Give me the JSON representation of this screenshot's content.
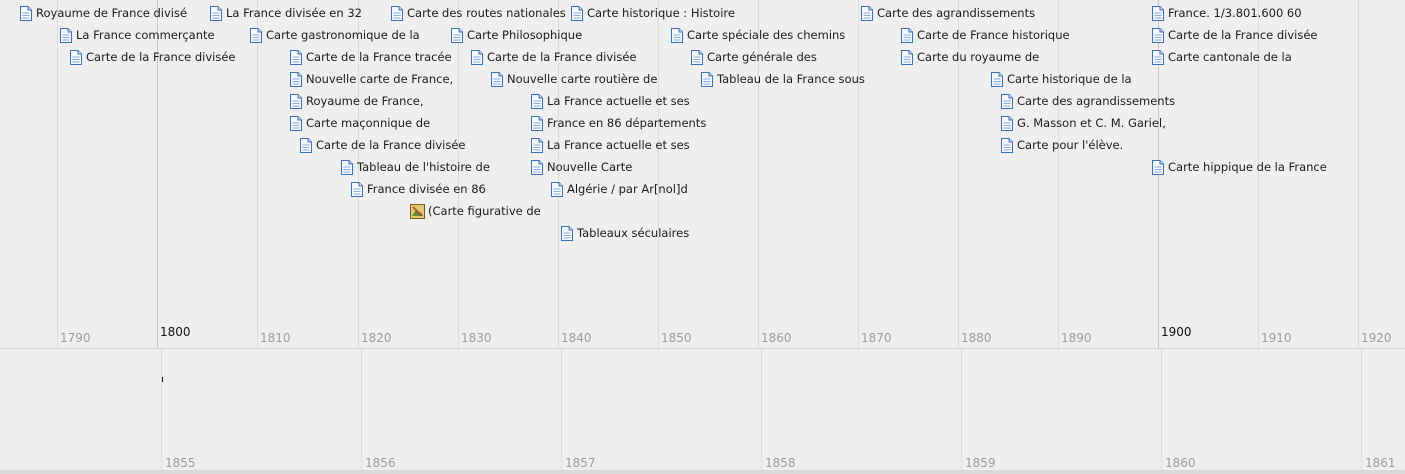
{
  "timeline": {
    "decade_labels": [
      "1790",
      "1800",
      "1810",
      "1820",
      "1830",
      "1840",
      "1850",
      "1860",
      "1870",
      "1880",
      "1890",
      "1900",
      "1910",
      "1920"
    ],
    "events": [
      {
        "label": "Royaume de France divisé",
        "icon": "document-icon"
      },
      {
        "label": "La France commerçante",
        "icon": "document-icon"
      },
      {
        "label": "Carte de la France divisée",
        "icon": "document-icon"
      },
      {
        "label": "La France divisée en 32",
        "icon": "document-icon"
      },
      {
        "label": "Carte gastronomique de la",
        "icon": "document-icon"
      },
      {
        "label": "Carte de la France tracée",
        "icon": "document-icon"
      },
      {
        "label": "Nouvelle carte de France,",
        "icon": "document-icon"
      },
      {
        "label": "Royaume de France,",
        "icon": "document-icon"
      },
      {
        "label": "Carte maçonnique de",
        "icon": "document-icon"
      },
      {
        "label": "Carte de la France divisée",
        "icon": "document-icon"
      },
      {
        "label": "Tableau de l'histoire de",
        "icon": "document-icon"
      },
      {
        "label": "France divisée en 86",
        "icon": "document-icon"
      },
      {
        "label": "(Carte figurative de",
        "icon": "image-icon"
      },
      {
        "label": "Carte des routes nationales",
        "icon": "document-icon"
      },
      {
        "label": "Carte Philosophique",
        "icon": "document-icon"
      },
      {
        "label": "Carte de la France divisée",
        "icon": "document-icon"
      },
      {
        "label": "Nouvelle carte routière de",
        "icon": "document-icon"
      },
      {
        "label": "Carte historique : Histoire",
        "icon": "document-icon"
      },
      {
        "label": "La France actuelle et ses",
        "icon": "document-icon"
      },
      {
        "label": "France en 86 départements",
        "icon": "document-icon"
      },
      {
        "label": "La France actuelle et ses",
        "icon": "document-icon"
      },
      {
        "label": "Nouvelle Carte",
        "icon": "document-icon"
      },
      {
        "label": "Algérie / par Ar[nol]d",
        "icon": "document-icon"
      },
      {
        "label": "Tableaux séculaires",
        "icon": "document-icon"
      },
      {
        "label": "Carte spéciale des chemins",
        "icon": "document-icon"
      },
      {
        "label": "Carte générale des",
        "icon": "document-icon"
      },
      {
        "label": "Tableau de la France sous",
        "icon": "document-icon"
      },
      {
        "label": "Carte des agrandissements",
        "icon": "document-icon"
      },
      {
        "label": "Carte de France historique",
        "icon": "document-icon"
      },
      {
        "label": "Carte du royaume de",
        "icon": "document-icon"
      },
      {
        "label": "Carte historique de la",
        "icon": "document-icon"
      },
      {
        "label": "Carte des agrandissements",
        "icon": "document-icon"
      },
      {
        "label": "G. Masson et C. M. Gariel,",
        "icon": "document-icon"
      },
      {
        "label": "Carte pour l'élève.",
        "icon": "document-icon"
      },
      {
        "label": "France. 1/3.801.600 60",
        "icon": "document-icon"
      },
      {
        "label": "Carte de la France divisée",
        "icon": "document-icon"
      },
      {
        "label": "Carte cantonale de la",
        "icon": "document-icon"
      },
      {
        "label": "Carte hippique de la France",
        "icon": "document-icon"
      }
    ]
  },
  "overview": {
    "year_labels": [
      "1855",
      "1856",
      "1857",
      "1858",
      "1859",
      "1860",
      "1861"
    ]
  }
}
